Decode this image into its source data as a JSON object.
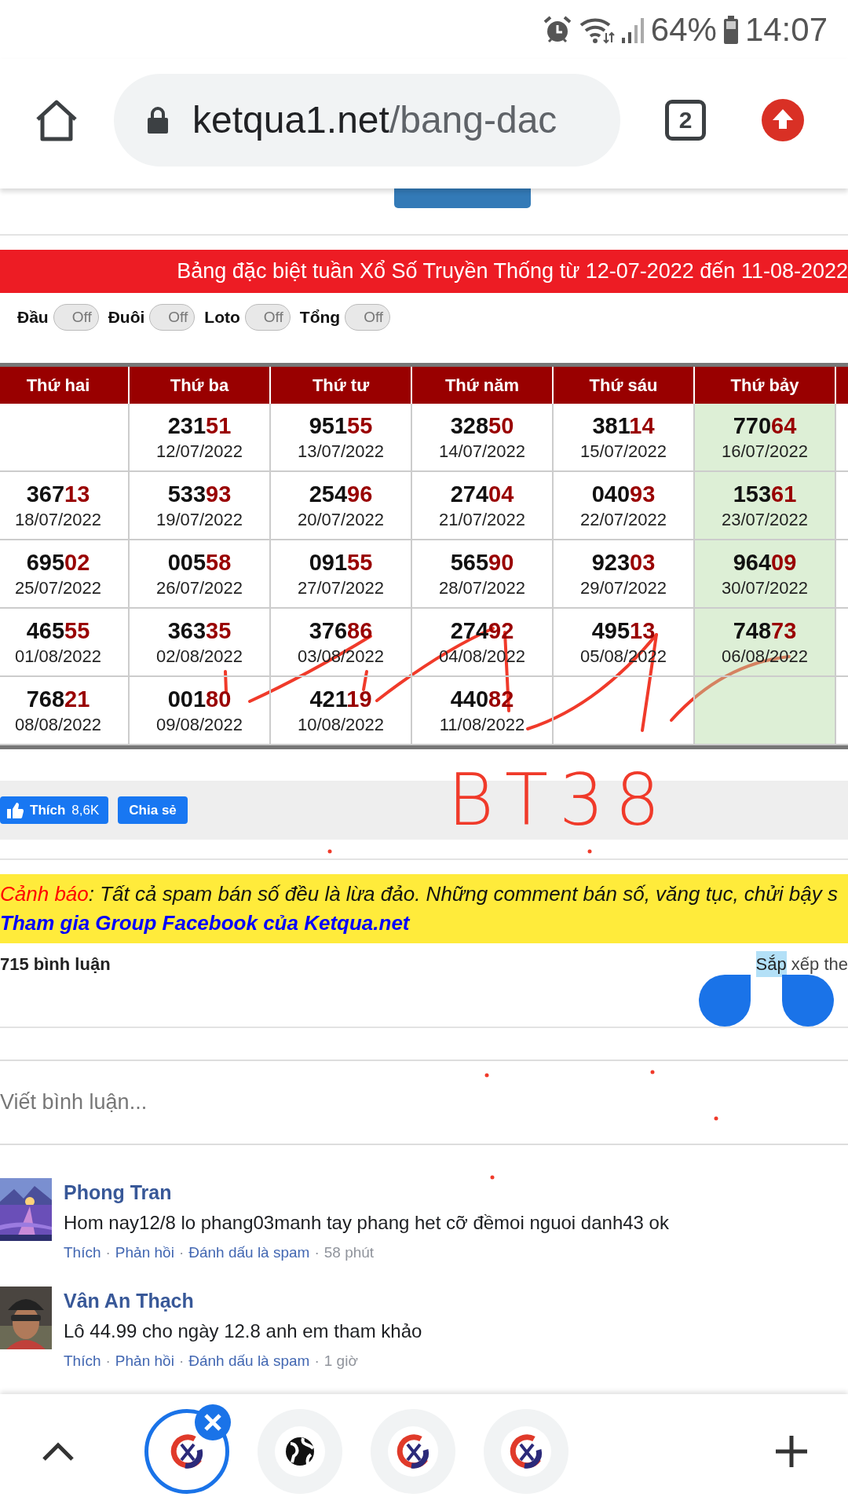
{
  "status_bar": {
    "battery": "64%",
    "time": "14:07"
  },
  "browser": {
    "url_host": "ketqua1.net",
    "url_path": "/bang-dac",
    "tab_count": "2"
  },
  "banner": {
    "title": "Bảng đặc biệt tuần Xổ Số Truyền Thống từ 12-07-2022 đến 11-08-2022"
  },
  "toggles": [
    {
      "label": "Đầu",
      "state": "Off",
      "on": false
    },
    {
      "label": "Đuôi",
      "state": "Off",
      "on": false
    },
    {
      "label": "Loto",
      "state": "Off",
      "on": false
    },
    {
      "label": "Tổng",
      "state": "Off",
      "on": false
    }
  ],
  "table": {
    "columns": [
      {
        "label": "Thứ hai",
        "highlighted": false
      },
      {
        "label": "Thứ ba",
        "highlighted": false
      },
      {
        "label": "Thứ tư",
        "highlighted": false
      },
      {
        "label": "Thứ năm",
        "highlighted": false
      },
      {
        "label": "Thứ sáu",
        "highlighted": false
      },
      {
        "label": "Thứ bảy",
        "highlighted": true
      }
    ],
    "rows": [
      [
        {
          "kind": "empty"
        },
        {
          "kind": "result",
          "head": "231",
          "tail": "51",
          "date": "12/07/2022"
        },
        {
          "kind": "result",
          "head": "951",
          "tail": "55",
          "date": "13/07/2022"
        },
        {
          "kind": "result",
          "head": "328",
          "tail": "50",
          "date": "14/07/2022"
        },
        {
          "kind": "result",
          "head": "381",
          "tail": "14",
          "date": "15/07/2022"
        },
        {
          "kind": "result",
          "head": "770",
          "tail": "64",
          "date": "16/07/2022"
        }
      ],
      [
        {
          "kind": "result",
          "head": "367",
          "tail": "13",
          "date": "18/07/2022"
        },
        {
          "kind": "result",
          "head": "533",
          "tail": "93",
          "date": "19/07/2022"
        },
        {
          "kind": "result",
          "head": "254",
          "tail": "96",
          "date": "20/07/2022"
        },
        {
          "kind": "result",
          "head": "274",
          "tail": "04",
          "date": "21/07/2022"
        },
        {
          "kind": "result",
          "head": "040",
          "tail": "93",
          "date": "22/07/2022"
        },
        {
          "kind": "result",
          "head": "153",
          "tail": "61",
          "date": "23/07/2022"
        }
      ],
      [
        {
          "kind": "result",
          "head": "695",
          "tail": "02",
          "date": "25/07/2022"
        },
        {
          "kind": "result",
          "head": "005",
          "tail": "58",
          "date": "26/07/2022"
        },
        {
          "kind": "result",
          "head": "091",
          "tail": "55",
          "date": "27/07/2022"
        },
        {
          "kind": "result",
          "head": "565",
          "tail": "90",
          "date": "28/07/2022"
        },
        {
          "kind": "result",
          "head": "923",
          "tail": "03",
          "date": "29/07/2022"
        },
        {
          "kind": "result",
          "head": "964",
          "tail": "09",
          "date": "30/07/2022"
        }
      ],
      [
        {
          "kind": "result",
          "head": "465",
          "tail": "55",
          "date": "01/08/2022"
        },
        {
          "kind": "result",
          "head": "363",
          "tail": "35",
          "date": "02/08/2022"
        },
        {
          "kind": "result",
          "head": "376",
          "tail": "86",
          "date": "03/08/2022"
        },
        {
          "kind": "result",
          "head": "274",
          "tail": "92",
          "date": "04/08/2022"
        },
        {
          "kind": "result",
          "head": "495",
          "tail": "13",
          "date": "05/08/2022"
        },
        {
          "kind": "result",
          "head": "748",
          "tail": "73",
          "date": "06/08/2022"
        }
      ],
      [
        {
          "kind": "result",
          "head": "768",
          "tail": "21",
          "date": "08/08/2022"
        },
        {
          "kind": "result",
          "head": "001",
          "tail": "80",
          "date": "09/08/2022"
        },
        {
          "kind": "result",
          "head": "421",
          "tail": "19",
          "date": "10/08/2022"
        },
        {
          "kind": "result",
          "head": "440",
          "tail": "82",
          "date": "11/08/2022"
        },
        {
          "kind": "empty"
        },
        {
          "kind": "empty"
        }
      ]
    ]
  },
  "handwritten_note": "BT38",
  "social": {
    "like_label": "Thích",
    "like_count": "8,6K",
    "share_label": "Chia sẻ"
  },
  "warning": {
    "label": "Cảnh báo",
    "text": ": Tất cả spam bán số đều là lừa đảo. Những comment bán số, văng tục, chửi bậy s",
    "link": "Tham gia Group Facebook của Ketqua.net"
  },
  "comments_header": {
    "count": "715 bình luận",
    "sort_selected": "Sắp",
    "sort_rest": " xếp the"
  },
  "composer": {
    "placeholder": "Viết bình luận..."
  },
  "comment_separator": "·",
  "comments": [
    {
      "name": "Phong Tran",
      "text": "Hom nay12/8 lo phang03manh tay phang het cỡ đềmoi nguoi danh43 ok",
      "actions": [
        "Thích",
        "Phản hồi",
        "Đánh dấu là spam"
      ],
      "time": "58 phút"
    },
    {
      "name": "Vân An Thạch",
      "text": "Lô 44.99 cho ngày 12.8 anh em tham khảo",
      "actions": [
        "Thích",
        "Phản hồi",
        "Đánh dấu là spam"
      ],
      "time": "1 giờ"
    }
  ],
  "tabs": [
    {
      "kind": "logo",
      "selected": true
    },
    {
      "kind": "globe",
      "selected": false
    },
    {
      "kind": "logo",
      "selected": false
    },
    {
      "kind": "logo",
      "selected": false
    }
  ]
}
